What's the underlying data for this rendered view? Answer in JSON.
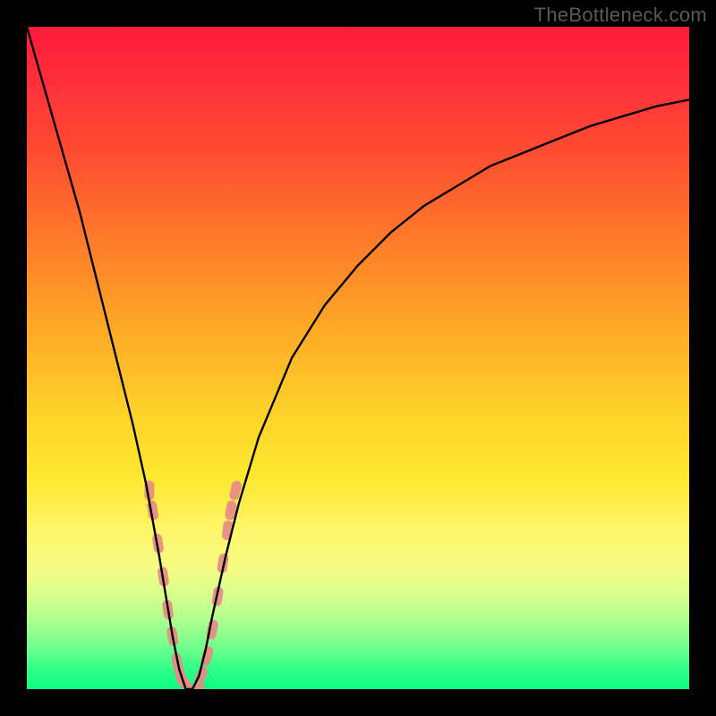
{
  "watermark": "TheBottleneck.com",
  "chart_data": {
    "type": "line",
    "title": "",
    "xlabel": "",
    "ylabel": "",
    "xlim": [
      0,
      100
    ],
    "ylim": [
      0,
      100
    ],
    "background_gradient": {
      "top_color": "#ff1a3a",
      "bottom_color": "#0dfc83",
      "description": "vertical red-to-green gradient indicating bottleneck severity (red high, green low)"
    },
    "series": [
      {
        "name": "bottleneck-curve",
        "color": "#000000",
        "x": [
          0,
          2,
          4,
          6,
          8,
          10,
          12,
          14,
          16,
          18,
          20,
          21,
          22,
          23,
          24,
          25,
          26,
          27,
          28,
          30,
          32,
          35,
          40,
          45,
          50,
          55,
          60,
          65,
          70,
          75,
          80,
          85,
          90,
          95,
          100
        ],
        "y": [
          100,
          93,
          86,
          79,
          72,
          64,
          56,
          48,
          40,
          31,
          20,
          14,
          8,
          3,
          0,
          0,
          2,
          6,
          11,
          20,
          28,
          38,
          50,
          58,
          64,
          69,
          73,
          76,
          79,
          81,
          83,
          85,
          86.5,
          88,
          89
        ]
      },
      {
        "name": "data-markers",
        "type": "scatter",
        "color": "#e68a85",
        "marker": "rounded-bar",
        "x": [
          18.5,
          19.0,
          19.8,
          20.6,
          21.3,
          22.0,
          22.7,
          23.2,
          23.8,
          24.4,
          25.5,
          26.3,
          27.2,
          28.0,
          28.8,
          29.6,
          30.3,
          30.8,
          31.5
        ],
        "y": [
          30,
          27,
          22,
          17,
          12,
          8,
          4,
          2,
          1,
          0,
          0,
          2,
          5,
          9,
          14,
          19,
          24,
          27,
          30
        ]
      }
    ],
    "minimum_point": {
      "x": 25,
      "y": 0
    }
  }
}
